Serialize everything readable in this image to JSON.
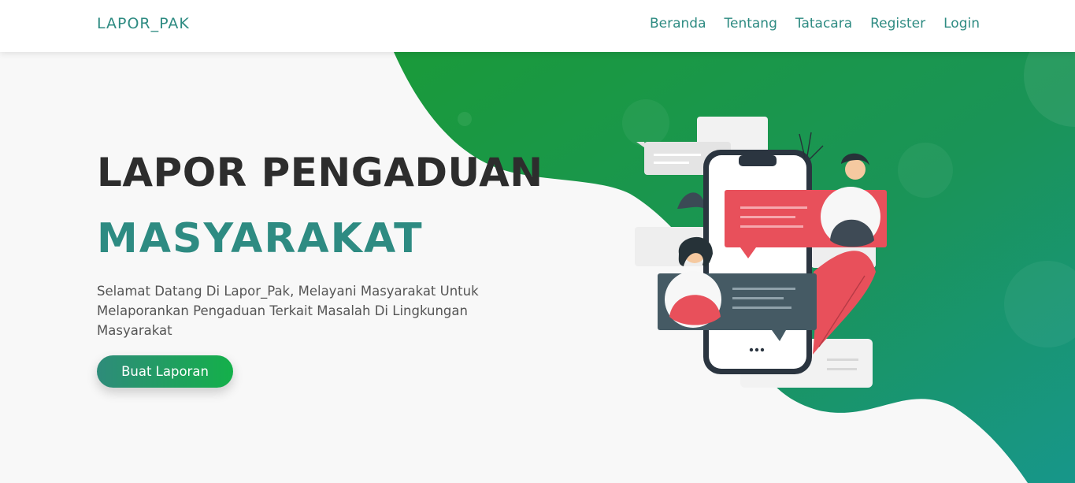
{
  "nav": {
    "brand": "LAPOR_PAK",
    "links": [
      "Beranda",
      "Tentang",
      "Tatacara",
      "Register",
      "Login"
    ]
  },
  "hero": {
    "title_line1": "LAPOR PENGADUAN",
    "title_line2": "MASYARAKAT",
    "description": "Selamat Datang Di Lapor_Pak, Melayani Masyarakat Untuk Melaporankan Pengaduan Terkait Masalah Di Lingkungan Masyarakat",
    "cta_label": "Buat Laporan"
  },
  "colors": {
    "brand_teal": "#2e8b82",
    "green": "#1a9a3a",
    "chat_red": "#e8505b",
    "chat_dark": "#455a64"
  }
}
